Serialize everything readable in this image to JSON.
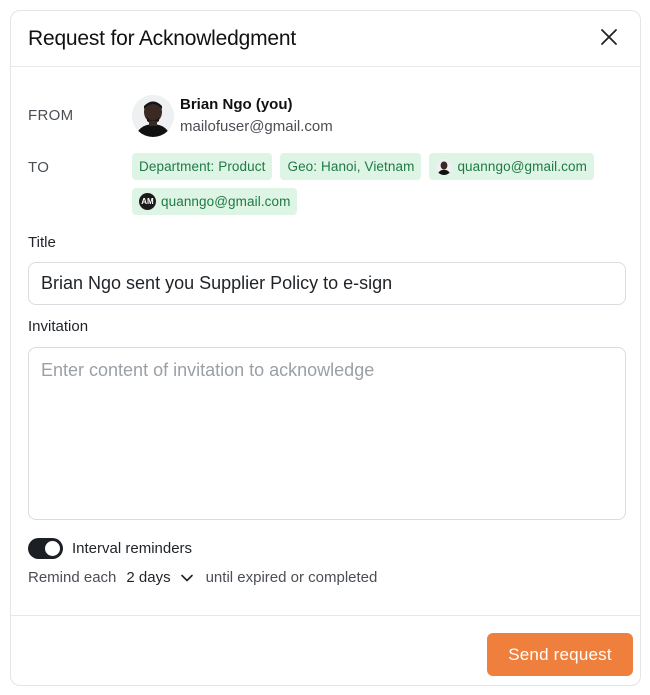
{
  "dialog": {
    "title": "Request for Acknowledgment"
  },
  "from": {
    "label": "FROM",
    "name": "Brian Ngo (you)",
    "email": "mailofuser@gmail.com"
  },
  "to": {
    "label": "TO",
    "chips": [
      {
        "text": "Department: Product"
      },
      {
        "text": "Geo: Hanoi, Vietnam"
      },
      {
        "text": "quanngo@gmail.com"
      },
      {
        "text": "quanngo@gmail.com",
        "initials": "AM"
      }
    ]
  },
  "title_field": {
    "label": "Title",
    "value": "Brian Ngo sent you Supplier Policy to e-sign"
  },
  "invitation_field": {
    "label": "Invitation",
    "placeholder": "Enter content of invitation to acknowledge",
    "value": ""
  },
  "reminders": {
    "toggle_label": "Interval reminders",
    "enabled": true,
    "remind_label": "Remind each",
    "interval": "2 days",
    "suffix": "until expired or completed"
  },
  "footer": {
    "send_label": "Send request"
  },
  "colors": {
    "accent": "#ef7f3c",
    "chip_bg": "#def4e5",
    "chip_text": "#1f7a44",
    "toggle_on": "#1c1f23"
  },
  "icons": {
    "close": "close-icon",
    "chevron": "chevron-down-icon"
  }
}
